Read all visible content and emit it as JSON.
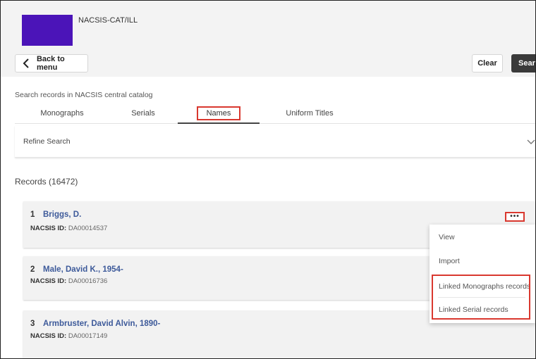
{
  "header": {
    "app_title": "NACSIS-CAT/ILL"
  },
  "toolbar": {
    "back_label": "Back to menu",
    "clear_label": "Clear",
    "search_label": "Search"
  },
  "search": {
    "caption": "Search records in NACSIS central catalog",
    "tabs": [
      {
        "label": "Monographs"
      },
      {
        "label": "Serials"
      },
      {
        "label": "Names"
      },
      {
        "label": "Uniform Titles"
      }
    ],
    "active_tab": "Names"
  },
  "refine": {
    "label": "Refine Search"
  },
  "records": {
    "count_label": "Records (16472)",
    "id_label": "NACSIS ID:",
    "items": [
      {
        "num": "1",
        "title": "Briggs, D.",
        "id": "DA00014537"
      },
      {
        "num": "2",
        "title": "Male, David K., 1954-",
        "id": "DA00016736"
      },
      {
        "num": "3",
        "title": "Armbruster, David Alvin, 1890-",
        "id": "DA00017149"
      }
    ]
  },
  "row_actions": {
    "more_label": "•••",
    "menu": [
      "View",
      "Import",
      "Linked Monographs records",
      "Linked Serial records"
    ]
  },
  "colors": {
    "logo": "#4b14b8",
    "highlight": "#d9382f",
    "link": "#3d5a9a",
    "search_button": "#3a3a3a"
  }
}
